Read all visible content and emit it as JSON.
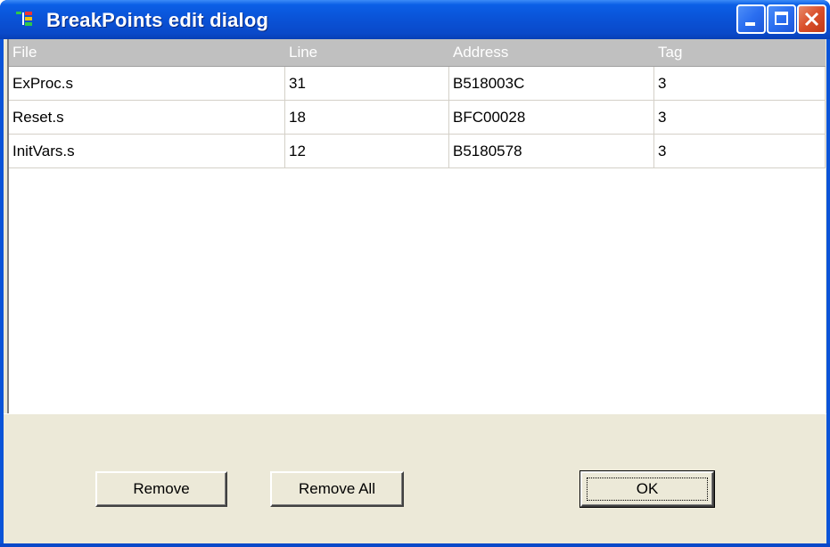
{
  "window": {
    "title": "BreakPoints edit dialog",
    "colors": {
      "titlebar": "#0a52d6",
      "close_button": "#d94f2a",
      "header_bg": "#c0c0c0",
      "dialog_bg": "#ece9d8"
    }
  },
  "titlebar_buttons": {
    "minimize_icon": "minimize-icon",
    "maximize_icon": "maximize-icon",
    "close_icon": "close-icon"
  },
  "table": {
    "columns": [
      "File",
      "Line",
      "Address",
      "Tag"
    ],
    "rows": [
      [
        "ExProc.s",
        "31",
        "B518003C",
        "3"
      ],
      [
        "Reset.s",
        "18",
        "BFC00028",
        "3"
      ],
      [
        "InitVars.s",
        "12",
        "B5180578",
        "3"
      ]
    ]
  },
  "buttons": {
    "remove": "Remove",
    "remove_all": "Remove All",
    "ok": "OK"
  }
}
